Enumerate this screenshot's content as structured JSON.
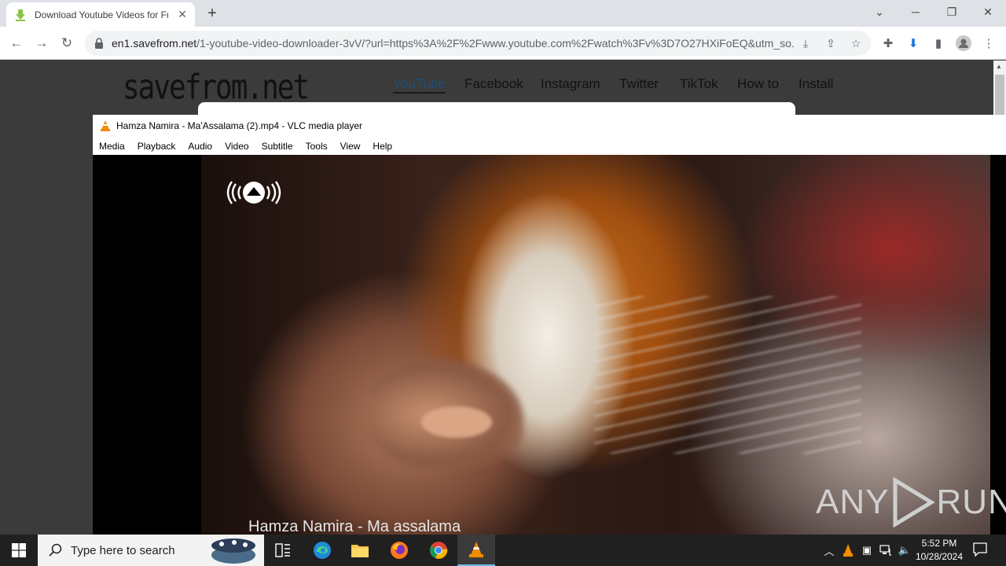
{
  "browser": {
    "tab_title": "Download Youtube Videos for Free",
    "url_host": "en1.savefrom.net",
    "url_rest": "/1-youtube-video-downloader-3vV/?url=https%3A%2F%2Fwww.youtube.com%2Fwatch%3Fv%3D7O27HXiFoEQ&utm_so..."
  },
  "site": {
    "logo": "savefrom.net",
    "nav": [
      "YouTube",
      "Facebook",
      "Instagram",
      "Twitter",
      "TikTok",
      "How to",
      "Install"
    ]
  },
  "vlc": {
    "title": "Hamza Namira - Ma'Assalama  (2).mp4 - VLC media player",
    "menu": [
      "Media",
      "Playback",
      "Audio",
      "Video",
      "Subtitle",
      "Tools",
      "View",
      "Help"
    ],
    "caption": "Hamza Namira - Ma assalama",
    "watermark": "ANY",
    "watermark2": "RUN"
  },
  "taskbar": {
    "search_placeholder": "Type here to search",
    "time": "5:52 PM",
    "date": "10/28/2024"
  },
  "colors": {
    "accent": "#76b9ed",
    "vlc_orange": "#f28c00"
  }
}
